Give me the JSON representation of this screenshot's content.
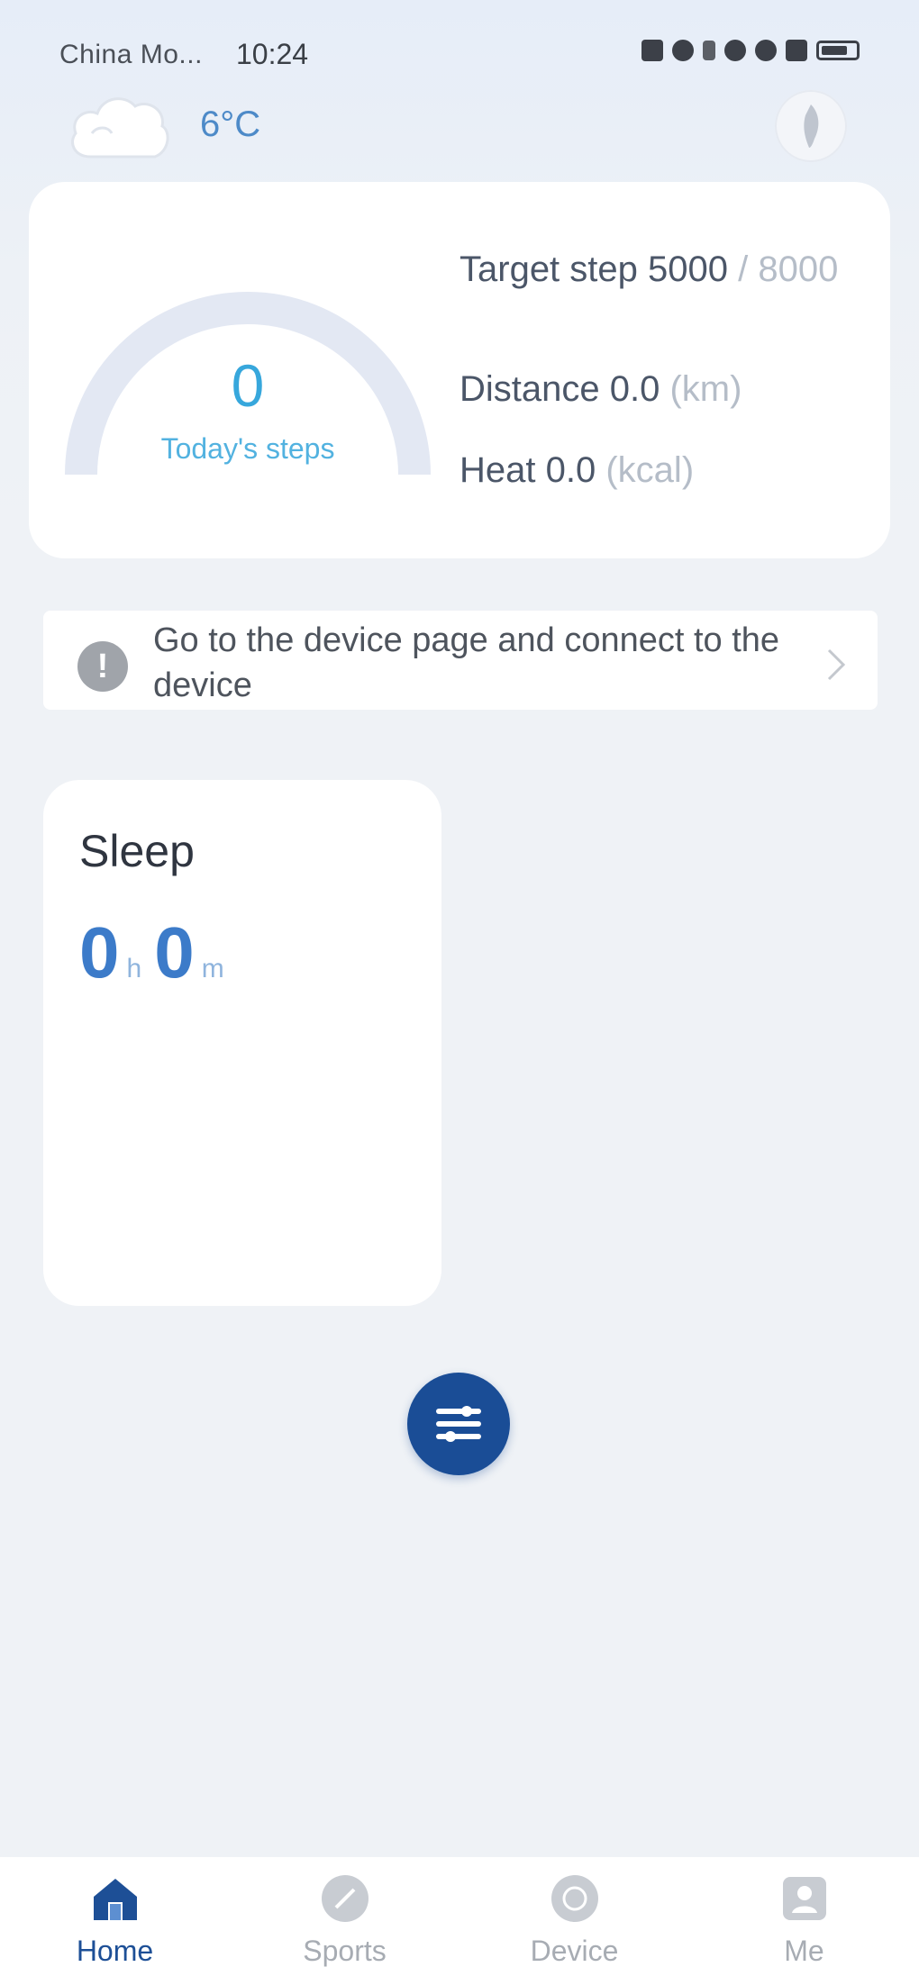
{
  "status_bar": {
    "carrier": "China Mo...",
    "time": "10:24"
  },
  "weather": {
    "icon": "cloud-icon",
    "temperature": "6°C"
  },
  "steps_card": {
    "today_steps_value": "0",
    "today_steps_label": "Today's steps",
    "target_label": "Target step",
    "target_current": "5000",
    "target_separator": "/",
    "target_goal": "8000",
    "distance_label": "Distance",
    "distance_value": "0.0",
    "distance_unit": "(km)",
    "heat_label": "Heat",
    "heat_value": "0.0",
    "heat_unit": "(kcal)",
    "progress_fraction": 0
  },
  "notice": {
    "icon": "info-icon",
    "text": "Go to the device page and connect to the device"
  },
  "sleep_card": {
    "title": "Sleep",
    "hours": "0",
    "hours_unit": "h",
    "minutes": "0",
    "minutes_unit": "m"
  },
  "colors": {
    "accent": "#1a4d96",
    "steps_accent": "#37a7dc",
    "sleep_accent": "#3c7bc9",
    "gauge_track": "#e3e8f3"
  },
  "bottom_nav": {
    "items": [
      {
        "label": "Home",
        "icon": "home-icon",
        "active": true
      },
      {
        "label": "Sports",
        "icon": "sports-icon",
        "active": false
      },
      {
        "label": "Device",
        "icon": "device-icon",
        "active": false
      },
      {
        "label": "Me",
        "icon": "me-icon",
        "active": false
      }
    ]
  }
}
